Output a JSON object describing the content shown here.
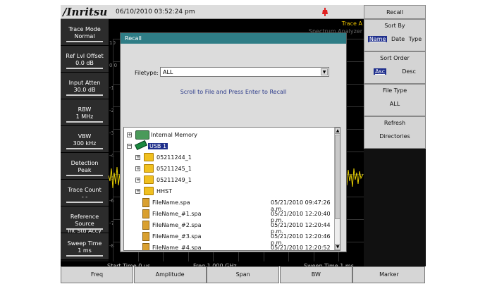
{
  "header": {
    "brand": "/Inritsu",
    "datetime": "06/10/2010 03:52:24 pm"
  },
  "graph": {
    "trace_label": "Trace A",
    "mode_label": "Spectrum Analyzer",
    "y_labels": [
      "10",
      "0.0",
      "-1",
      "-2",
      "-3",
      "-4",
      "-5",
      "-6",
      "-7",
      "-8"
    ],
    "start_time": "Start Time  0 µs",
    "freq": "Freq 1.000 GHz",
    "sweep_time": "Sweep Time  1 ms"
  },
  "left_menu": [
    {
      "title": "Trace Mode",
      "value": "Normal"
    },
    {
      "title": "Ref Lvl Offset",
      "value": "0.0 dB"
    },
    {
      "title": "Input Atten",
      "value": "30.0 dB"
    },
    {
      "title": "RBW",
      "value": "1 MHz"
    },
    {
      "title": "VBW",
      "value": "300 kHz"
    },
    {
      "title": "Detection",
      "value": "Peak"
    },
    {
      "title": "Trace Count",
      "value": "- -"
    },
    {
      "title": "Reference Source",
      "value": "Int Std Accy"
    },
    {
      "title": "Sweep Time",
      "value": "1 ms"
    }
  ],
  "right_menu": {
    "title": "Recall",
    "sort_by": {
      "label": "Sort By",
      "options": [
        "Name",
        "Date",
        "Type"
      ],
      "selected": "Name"
    },
    "sort_order": {
      "label": "Sort Order",
      "options": [
        "Asc",
        "Desc"
      ],
      "selected": "Asc"
    },
    "file_type": {
      "label": "File Type",
      "value": "ALL"
    },
    "refresh": {
      "label": "Refresh",
      "value": "Directories"
    }
  },
  "bottom_menu": [
    "Freq",
    "Amplitude",
    "Span",
    "BW",
    "Marker"
  ],
  "dialog": {
    "title": "Recall",
    "filetype_label": "Filetype:",
    "filetype_value": "ALL",
    "instruction": "Scroll to File and Press Enter to Recall",
    "tree": [
      {
        "name": "Internal Memory",
        "kind": "drive",
        "level": 0,
        "expander": "+"
      },
      {
        "name": "USB 1",
        "kind": "usb",
        "level": 0,
        "expander": "-",
        "selected": true
      },
      {
        "name": "05211244_1",
        "kind": "folder",
        "level": 1,
        "expander": "+"
      },
      {
        "name": "05211245_1",
        "kind": "folder",
        "level": 1,
        "expander": "+"
      },
      {
        "name": "05211249_1",
        "kind": "folder",
        "level": 1,
        "expander": "+"
      },
      {
        "name": "HHST",
        "kind": "folder",
        "level": 1,
        "expander": "+"
      },
      {
        "name": "FileName.spa",
        "kind": "file",
        "level": 1,
        "date": "05/21/2010 09:47:26 a.m."
      },
      {
        "name": "FileName_#1.spa",
        "kind": "file",
        "level": 1,
        "date": "05/21/2010 12:20:40 p.m."
      },
      {
        "name": "FileName_#2.spa",
        "kind": "file",
        "level": 1,
        "date": "05/21/2010 12:20:44 p.m."
      },
      {
        "name": "FileName_#3.spa",
        "kind": "file",
        "level": 1,
        "date": "05/21/2010 12:20:46 p.m."
      },
      {
        "name": "FileName_#4.spa",
        "kind": "file",
        "level": 1,
        "date": "05/21/2010 12:20:52 p.m."
      }
    ]
  }
}
